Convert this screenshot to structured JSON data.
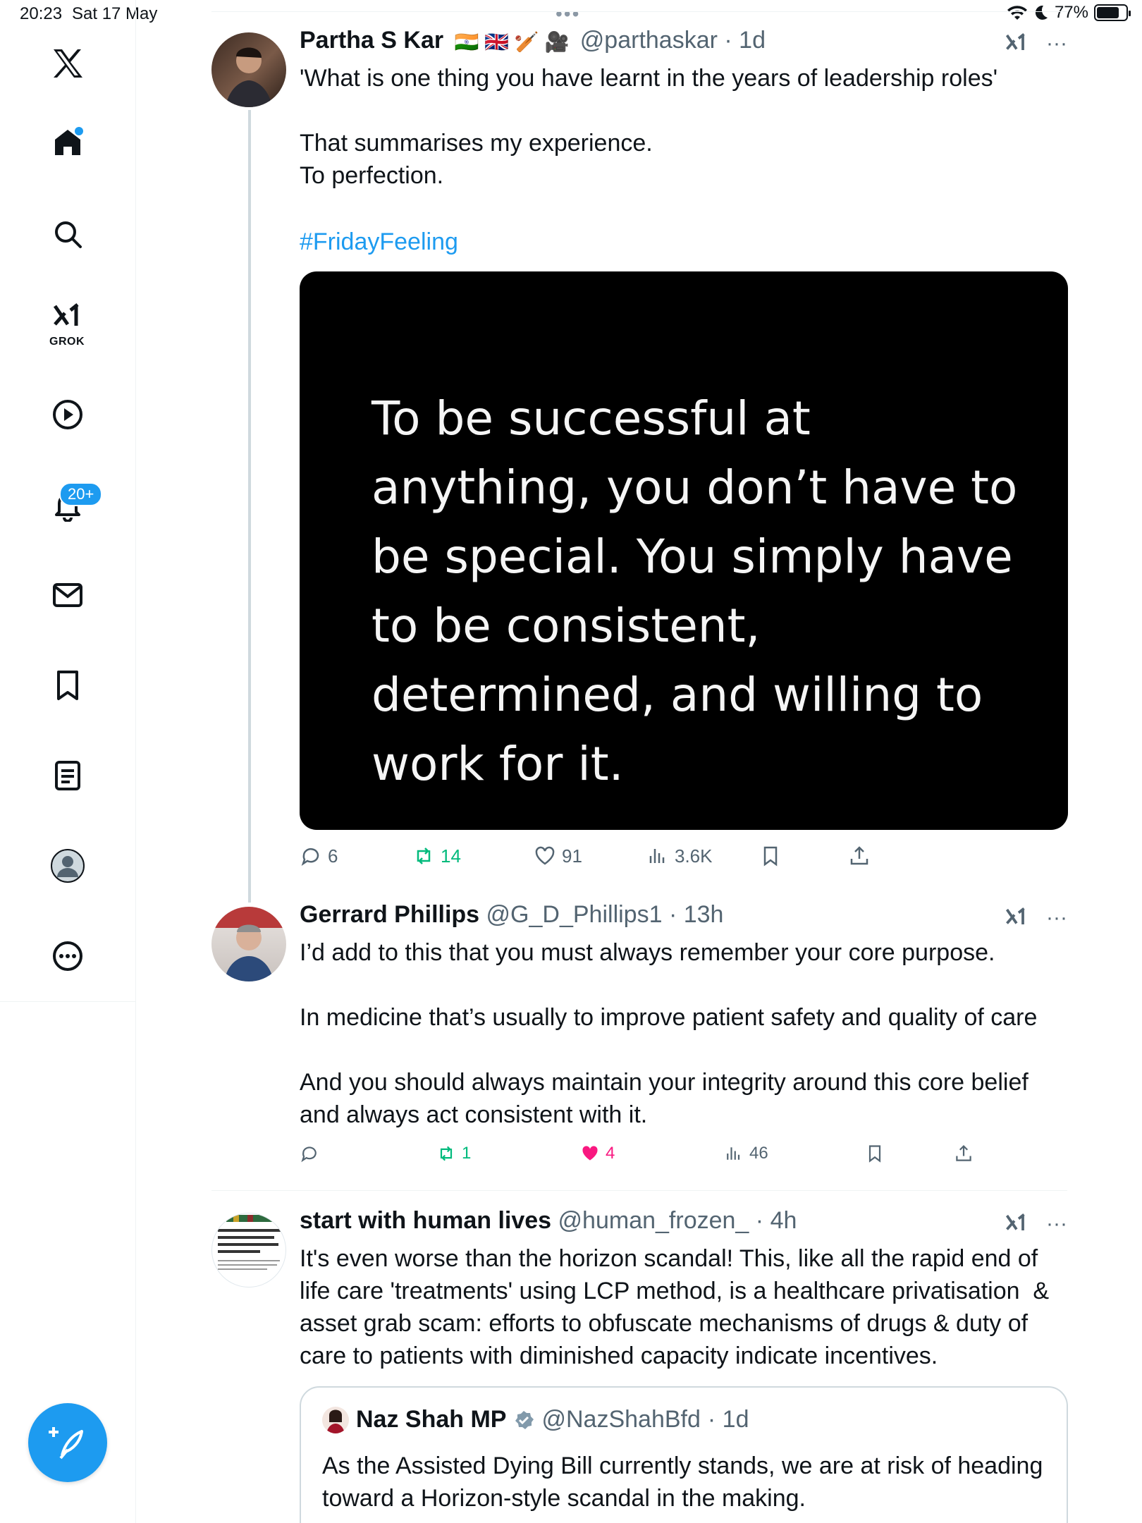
{
  "status_bar": {
    "time": "20:23",
    "date": "Sat 17 May",
    "battery": "77%",
    "battery_level": 0.77
  },
  "sidebar": {
    "items": [
      "X",
      "Home",
      "Search",
      "Grok",
      "Video",
      "Notifications",
      "Messages",
      "Bookmarks",
      "Lists",
      "Profile",
      "More"
    ],
    "grok_label": "GROK",
    "notifications_badge": "20+"
  },
  "tweets": [
    {
      "name": "Partha S Kar",
      "flags": "🇮🇳 🇬🇧 🏏 🎥",
      "handle": "@parthaskar",
      "time": "· 1d",
      "text": "'What is one thing you have learnt in the years of leadership roles'\n\nThat summarises my experience.\nTo perfection.",
      "hashtag": "#FridayFeeling",
      "image_text": "To be successful at anything, you don’t have to be special. You simply have to be consistent, determined, and willing to work for it.",
      "replies": "6",
      "reposts": "14",
      "likes": "91",
      "views": "3.6K"
    },
    {
      "name": "Gerrard Phillips",
      "handle": "@G_D_Phillips1",
      "time": "· 13h",
      "text": "I’d add to this that you must always remember your core purpose.\n\nIn medicine that’s usually to improve patient safety and quality of care\n\nAnd you should always maintain your integrity around this core belief\nand always act consistent with it.",
      "replies": "",
      "reposts": "1",
      "likes": "4",
      "views": "46"
    },
    {
      "name": "start with human lives",
      "handle": "@human_frozen_",
      "time": "· 4h",
      "text": "It's even worse than the horizon scandal! This, like all the rapid end of\nlife care 'treatments' using LCP method, is a healthcare privatisation  &\nasset grab scam: efforts to obfuscate mechanisms of drugs & duty of\ncare to patients with diminished capacity indicate incentives.",
      "avatar_text": "How Britain's excess Covid deaths have cut the state pension burden by £1.5bn",
      "quoted": {
        "name": "Naz Shah MP",
        "handle": "@NazShahBfd",
        "time": "· 1d",
        "text": "As the Assisted Dying Bill currently stands, we are at risk of heading toward a Horizon-style scandal in the making."
      }
    }
  ],
  "colors": {
    "accent": "#1d9bf0",
    "repost": "#00ba7c",
    "like": "#f91880",
    "muted": "#536471"
  }
}
